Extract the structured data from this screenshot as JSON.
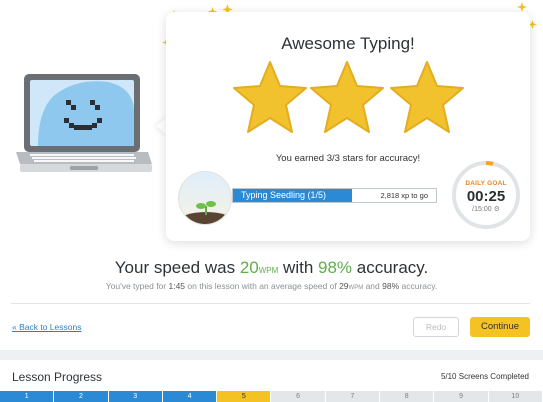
{
  "card": {
    "title": "Awesome Typing!",
    "stars_earned": 3,
    "stars_total": 3,
    "accuracy_message": "You earned 3/3 stars for accuracy!",
    "level": {
      "label": "Typing Seedling (1/5)",
      "xp_text": "2,818 xp to go"
    },
    "daily_goal": {
      "title": "DAILY GOAL",
      "time": "00:25",
      "target": "/15:00"
    }
  },
  "result": {
    "speed_prefix": "Your speed was ",
    "speed_value": "20",
    "speed_unit": "WPM",
    "speed_middle": " with ",
    "accuracy_value": "98%",
    "speed_suffix": " accuracy.",
    "detail_1": "You've typed for ",
    "detail_time": "1:45",
    "detail_2": " on this lesson with an average speed of ",
    "detail_speed": "29",
    "detail_unit": "WPM",
    "detail_3": " and ",
    "detail_accuracy": "98%",
    "detail_4": " accuracy."
  },
  "actions": {
    "back_label": "« Back to Lessons",
    "redo_label": "Redo",
    "continue_label": "Continue"
  },
  "lesson_progress": {
    "title": "Lesson Progress",
    "count_text": "5/10 Screens Completed",
    "segments": [
      {
        "label": "1",
        "state": "done"
      },
      {
        "label": "2",
        "state": "done"
      },
      {
        "label": "3",
        "state": "done"
      },
      {
        "label": "4",
        "state": "done"
      },
      {
        "label": "5",
        "state": "current"
      },
      {
        "label": "6",
        "state": "todo"
      },
      {
        "label": "7",
        "state": "todo"
      },
      {
        "label": "8",
        "state": "todo"
      },
      {
        "label": "9",
        "state": "todo"
      },
      {
        "label": "10",
        "state": "todo"
      }
    ]
  },
  "colors": {
    "accent_blue": "#2a8ad6",
    "accent_yellow": "#f5c224",
    "success_green": "#5fae4a",
    "goal_orange": "#e8852a"
  }
}
